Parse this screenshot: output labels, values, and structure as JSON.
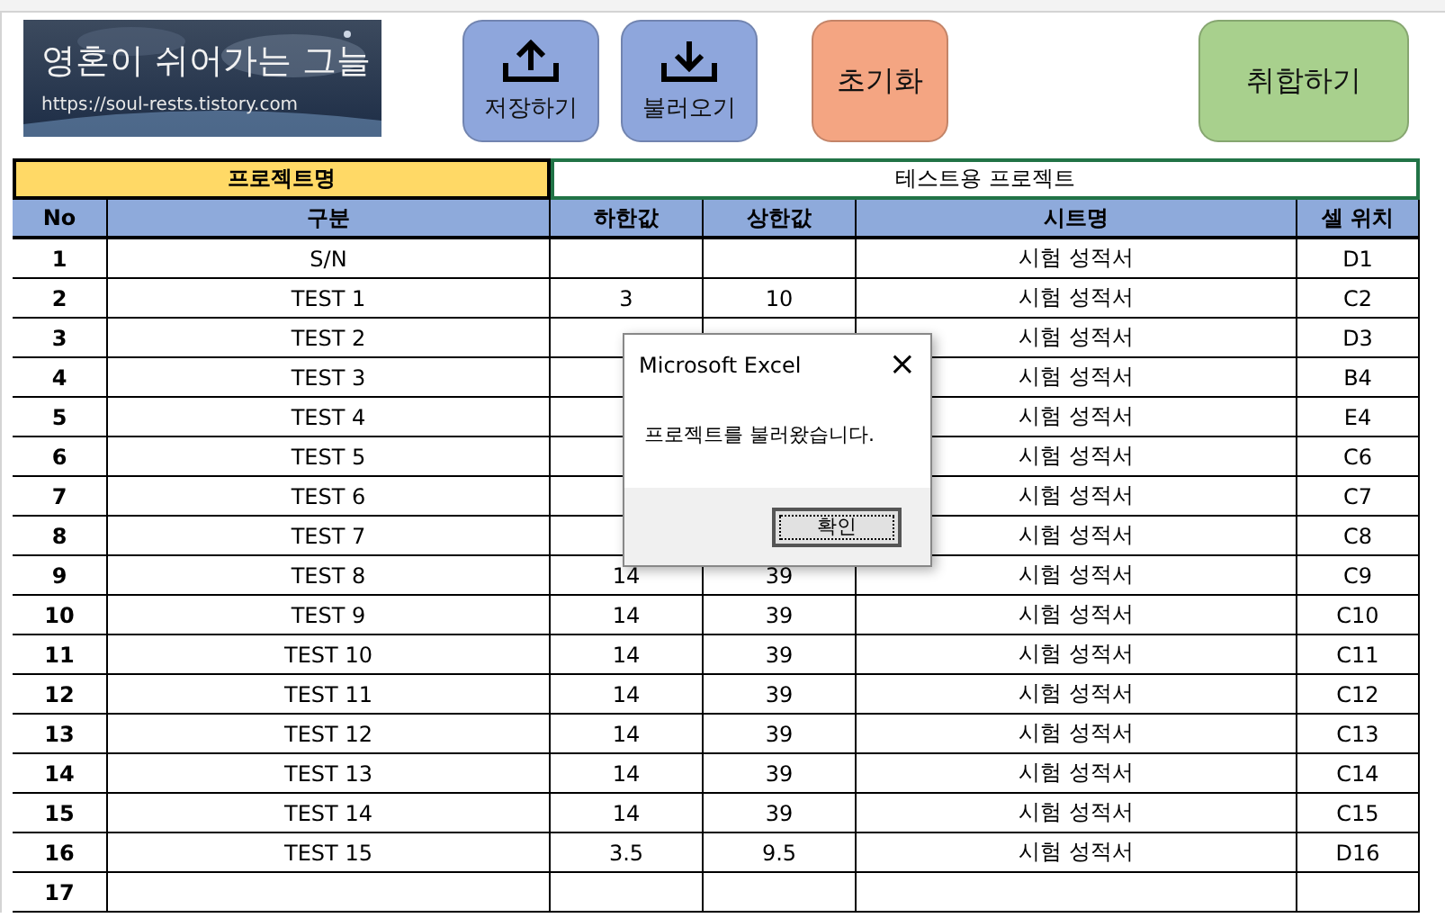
{
  "logo": {
    "title": "영혼이 쉬어가는 그늘",
    "url": "https://soul-rests.tistory.com"
  },
  "buttons": [
    {
      "label": "저장하기",
      "kind": "upload",
      "color": "#8ea6dc"
    },
    {
      "label": "불러오기",
      "kind": "download",
      "color": "#8ea6dc"
    },
    {
      "label": "초기화",
      "kind": "plain",
      "color": "#f4a582"
    },
    {
      "label": "취합하기",
      "kind": "plain",
      "color": "#a8d08d"
    }
  ],
  "project": {
    "label": "프로젝트명",
    "value": "테스트용 프로젝트"
  },
  "table": {
    "columns": [
      "No",
      "구분",
      "하한값",
      "상한값",
      "시트명",
      "셀 위치"
    ],
    "rows": [
      [
        "1",
        "S/N",
        "",
        "",
        "시험 성적서",
        "D1"
      ],
      [
        "2",
        "TEST 1",
        "3",
        "10",
        "시험 성적서",
        "C2"
      ],
      [
        "3",
        "TEST 2",
        null,
        null,
        "시험 성적서",
        "D3"
      ],
      [
        "4",
        "TEST 3",
        null,
        null,
        "시험 성적서",
        "B4"
      ],
      [
        "5",
        "TEST 4",
        null,
        null,
        "시험 성적서",
        "E4"
      ],
      [
        "6",
        "TEST 5",
        null,
        null,
        "시험 성적서",
        "C6"
      ],
      [
        "7",
        "TEST 6",
        null,
        null,
        "시험 성적서",
        "C7"
      ],
      [
        "8",
        "TEST 7",
        null,
        null,
        "시험 성적서",
        "C8"
      ],
      [
        "9",
        "TEST 8",
        "14",
        "39",
        "시험 성적서",
        "C9"
      ],
      [
        "10",
        "TEST 9",
        "14",
        "39",
        "시험 성적서",
        "C10"
      ],
      [
        "11",
        "TEST 10",
        "14",
        "39",
        "시험 성적서",
        "C11"
      ],
      [
        "12",
        "TEST 11",
        "14",
        "39",
        "시험 성적서",
        "C12"
      ],
      [
        "13",
        "TEST 12",
        "14",
        "39",
        "시험 성적서",
        "C13"
      ],
      [
        "14",
        "TEST 13",
        "14",
        "39",
        "시험 성적서",
        "C14"
      ],
      [
        "15",
        "TEST 14",
        "14",
        "39",
        "시험 성적서",
        "C15"
      ],
      [
        "16",
        "TEST 15",
        "3.5",
        "9.5",
        "시험 성적서",
        "D16"
      ],
      [
        "17",
        "",
        "",
        "",
        "",
        ""
      ]
    ]
  },
  "dialog": {
    "title": "Microsoft Excel",
    "close": "×",
    "message": "프로젝트를 불러왔습니다.",
    "button": "확인"
  }
}
